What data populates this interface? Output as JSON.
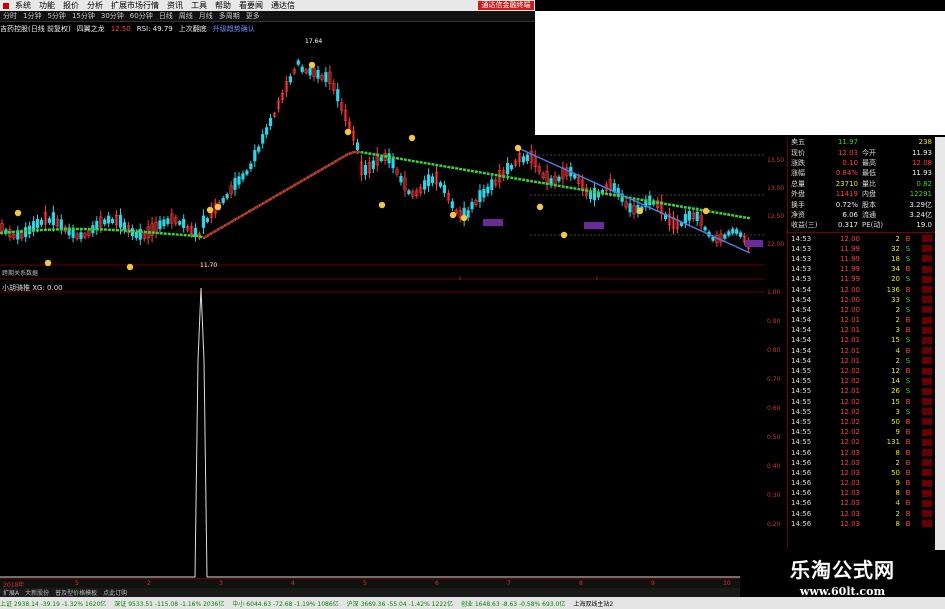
{
  "menu": {
    "items": [
      "系统",
      "功能",
      "报价",
      "分析",
      "扩展市场行情",
      "资讯",
      "工具",
      "帮助",
      "看要闻",
      "通达信"
    ],
    "brand": "通达信金融终端"
  },
  "periods": [
    "分时",
    "1分钟",
    "5分钟",
    "15分钟",
    "30分钟",
    "60分钟",
    "日线",
    "周线",
    "月线",
    "多周期",
    "更多"
  ],
  "title": {
    "stock": "吉药控股(日线 前复权)",
    "indicator": "四翼之龙",
    "v1": "12.50",
    "rsi": "RSI: 49.79",
    "tag": "上次翻底",
    "tag2": "升级趋势确认"
  },
  "main_annotations": {
    "peak": "17.64",
    "low": "11.70",
    "marker1": "1",
    "marker2": "1",
    "tags": [
      "买入",
      "买点",
      "卖出"
    ],
    "label_left": "跨期关系数据"
  },
  "indicator": {
    "label": "小胡骑推 XG: 0.00"
  },
  "price_axis": [
    "13.50",
    "13.00",
    "12.50",
    "12.00"
  ],
  "ind_axis": [
    "1.00",
    "0.90",
    "0.80",
    "0.70",
    "0.60",
    "0.50",
    "0.40",
    "0.30",
    "0.20",
    "0.10"
  ],
  "xaxis": [
    "2018年",
    "5",
    "2",
    "3",
    "4",
    "5",
    "6",
    "7",
    "8",
    "9",
    "10"
  ],
  "bottom_tabs": [
    "扩展A",
    "大新股份",
    "普及型价格模板",
    "点此订购"
  ],
  "status": [
    {
      "t": "上证 2938.14 -39.19 -1.32% 1620亿",
      "c": "dn"
    },
    {
      "t": "深证 9533.51 -115.08 -1.16% 2036亿",
      "c": "dn"
    },
    {
      "t": "中小 6044.63 -72.68 -1.19% 1086亿",
      "c": "dn"
    },
    {
      "t": "沪深 3669.36 -55.04 -1.42% 1222亿",
      "c": "dn"
    },
    {
      "t": "创业 1648.63 -8.63 -0.58% 693.0亿",
      "c": "dn"
    },
    {
      "t": "上海双线主站2",
      "c": ""
    }
  ],
  "quote": {
    "top": [
      {
        "k": "卖五",
        "v": "11.97",
        "vc": "green",
        "k2": "",
        "v2": "238",
        "v2c": "yellow"
      },
      {
        "k": "现价",
        "v": "12.03",
        "vc": "red",
        "k2": "今开",
        "v2": "11.93",
        "v2c": "white"
      },
      {
        "k": "涨跌",
        "v": "0.10",
        "vc": "red",
        "k2": "最高",
        "v2": "12.08",
        "v2c": "red"
      },
      {
        "k": "涨幅",
        "v": "0.84%",
        "vc": "red",
        "k2": "最低",
        "v2": "11.93",
        "v2c": "white"
      },
      {
        "k": "总量",
        "v": "23710",
        "vc": "yellow",
        "k2": "量比",
        "v2": "0.82",
        "v2c": "green"
      },
      {
        "k": "外盘",
        "v": "11419",
        "vc": "red",
        "k2": "内盘",
        "v2": "12291",
        "v2c": "green"
      },
      {
        "k": "换手",
        "v": "0.72%",
        "vc": "white",
        "k2": "股本",
        "v2": "3.29亿",
        "v2c": "white"
      },
      {
        "k": "净资",
        "v": "6.06",
        "vc": "white",
        "k2": "流通",
        "v2": "3.24亿",
        "v2c": "white"
      },
      {
        "k": "收益(三)",
        "v": "0.317",
        "vc": "white",
        "k2": "PE(动)",
        "v2": "19.0",
        "v2c": "white"
      }
    ],
    "ticks": [
      {
        "tm": "14:53",
        "pr": "12.00",
        "vol": "2",
        "bs": "B"
      },
      {
        "tm": "14:53",
        "pr": "11.99",
        "vol": "32",
        "bs": "S"
      },
      {
        "tm": "14:53",
        "pr": "11.99",
        "vol": "18",
        "bs": "S"
      },
      {
        "tm": "14:53",
        "pr": "11.99",
        "vol": "34",
        "bs": "B"
      },
      {
        "tm": "14:53",
        "pr": "11.99",
        "vol": "20",
        "bs": "S"
      },
      {
        "tm": "14:54",
        "pr": "12.00",
        "vol": "136",
        "bs": "B"
      },
      {
        "tm": "14:54",
        "pr": "12.00",
        "vol": "33",
        "bs": "S"
      },
      {
        "tm": "14:54",
        "pr": "12.00",
        "vol": "2",
        "bs": "S"
      },
      {
        "tm": "14:54",
        "pr": "12.01",
        "vol": "2",
        "bs": "B"
      },
      {
        "tm": "14:54",
        "pr": "12.01",
        "vol": "3",
        "bs": "B"
      },
      {
        "tm": "14:54",
        "pr": "12.01",
        "vol": "15",
        "bs": "S"
      },
      {
        "tm": "14:54",
        "pr": "12.01",
        "vol": "4",
        "bs": "B"
      },
      {
        "tm": "14:54",
        "pr": "12.01",
        "vol": "2",
        "bs": "S"
      },
      {
        "tm": "14:55",
        "pr": "12.02",
        "vol": "12",
        "bs": "B"
      },
      {
        "tm": "14:55",
        "pr": "12.02",
        "vol": "14",
        "bs": "S"
      },
      {
        "tm": "14:55",
        "pr": "12.01",
        "vol": "26",
        "bs": "S"
      },
      {
        "tm": "14:55",
        "pr": "12.02",
        "vol": "15",
        "bs": "B"
      },
      {
        "tm": "14:55",
        "pr": "12.02",
        "vol": "3",
        "bs": "S"
      },
      {
        "tm": "14:55",
        "pr": "12.02",
        "vol": "50",
        "bs": "B"
      },
      {
        "tm": "14:55",
        "pr": "12.02",
        "vol": "9",
        "bs": "B"
      },
      {
        "tm": "14:55",
        "pr": "12.02",
        "vol": "131",
        "bs": "B"
      },
      {
        "tm": "14:56",
        "pr": "12.03",
        "vol": "8",
        "bs": "B"
      },
      {
        "tm": "14:56",
        "pr": "12.03",
        "vol": "2",
        "bs": "B"
      },
      {
        "tm": "14:56",
        "pr": "12.03",
        "vol": "50",
        "bs": "B"
      },
      {
        "tm": "14:56",
        "pr": "12.03",
        "vol": "9",
        "bs": "B"
      },
      {
        "tm": "14:56",
        "pr": "12.03",
        "vol": "8",
        "bs": "B"
      },
      {
        "tm": "14:56",
        "pr": "12.03",
        "vol": "4",
        "bs": "B"
      },
      {
        "tm": "14:56",
        "pr": "12.03",
        "vol": "2",
        "bs": "B"
      },
      {
        "tm": "14:56",
        "pr": "12.03",
        "vol": "8",
        "bs": "B"
      }
    ]
  },
  "watermark": {
    "cn": "乐淘公式网",
    "url": "www.60lt.com"
  },
  "colors": {
    "up": "#ff3b3b",
    "down": "#2fd52f",
    "bg": "#000000",
    "ma_red": "#d81e1e",
    "ma_green": "#3ad13a",
    "trend": "#4a7fe0"
  }
}
